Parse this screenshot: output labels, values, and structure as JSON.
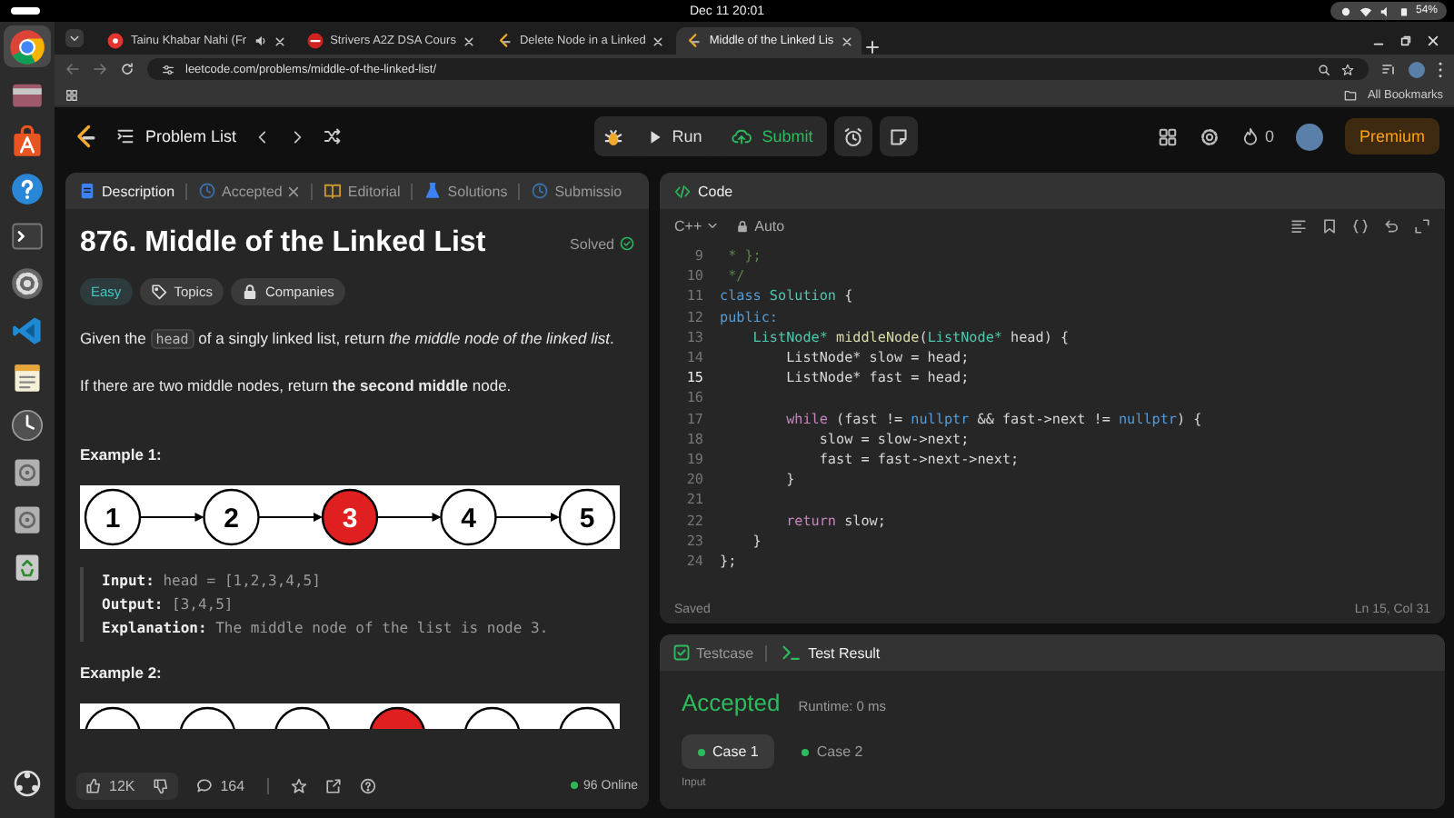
{
  "system_bar": {
    "datetime": "Dec 11  20:01",
    "battery": "54%"
  },
  "dock": [
    {
      "kind": "chrome",
      "selected": true
    },
    {
      "kind": "files",
      "selected": false
    },
    {
      "kind": "appstore",
      "selected": false
    },
    {
      "kind": "help",
      "selected": false
    },
    {
      "kind": "terminal",
      "selected": false
    },
    {
      "kind": "settings",
      "selected": false
    },
    {
      "kind": "vscode",
      "selected": false
    },
    {
      "kind": "notes",
      "selected": false
    },
    {
      "kind": "clock",
      "selected": false
    },
    {
      "kind": "disk",
      "selected": false
    },
    {
      "kind": "disk",
      "selected": false
    },
    {
      "kind": "trash",
      "selected": false
    },
    {
      "kind": "apps",
      "selected": false
    }
  ],
  "browser": {
    "tabs": [
      {
        "title": "Tainu Khabar Nahi (Fr",
        "kind": "music",
        "audio": true,
        "selected": false
      },
      {
        "title": "Strivers A2Z DSA Cours",
        "kind": "striver",
        "audio": false,
        "selected": false
      },
      {
        "title": "Delete Node in a Linked",
        "kind": "leetcode",
        "audio": false,
        "selected": false
      },
      {
        "title": "Middle of the Linked Lis",
        "kind": "leetcode",
        "audio": false,
        "selected": true
      }
    ],
    "url": "leetcode.com/problems/middle-of-the-linked-list/",
    "bookmarks": "All Bookmarks"
  },
  "header": {
    "problem_list": "Problem List",
    "run": "Run",
    "submit": "Submit",
    "streak": "0",
    "premium": "Premium"
  },
  "description_panel": {
    "tabs": [
      {
        "label": "Description",
        "kind": "description",
        "closable": false,
        "selected": true
      },
      {
        "label": "Accepted",
        "kind": "accepted",
        "closable": true,
        "selected": false
      },
      {
        "label": "Editorial",
        "kind": "editorial",
        "closable": false,
        "selected": false
      },
      {
        "label": "Solutions",
        "kind": "solutions",
        "closable": false,
        "selected": false
      },
      {
        "label": "Submissio",
        "kind": "submissions",
        "closable": false,
        "selected": false
      }
    ],
    "title": "876. Middle of the Linked List",
    "status": "Solved",
    "tags": [
      {
        "label": "Easy",
        "kind": "difficulty"
      },
      {
        "label": "Topics",
        "kind": "topics"
      },
      {
        "label": "Companies",
        "kind": "companies"
      }
    ],
    "statement": [
      {
        "kind": "text",
        "text": "Given the "
      },
      {
        "kind": "code",
        "text": "head"
      },
      {
        "kind": "text",
        "text": " of a singly linked list, return *the middle node of the linked list*."
      }
    ],
    "note": "If there are two middle nodes, return **the second middle** node.",
    "examples": [
      {
        "title": "Example 1:",
        "nodes": [
          {
            "label": "1",
            "highlighted": false
          },
          {
            "label": "2",
            "highlighted": false
          },
          {
            "label": "3",
            "highlighted": true
          },
          {
            "label": "4",
            "highlighted": false
          },
          {
            "label": "5",
            "highlighted": false
          }
        ],
        "lines": [
          "**Input:** head = [1,2,3,4,5]",
          "**Output:** [3,4,5]",
          "**Explanation:** The middle node of the list is node 3."
        ]
      },
      {
        "title": "Example 2:",
        "nodes": [
          {
            "highlighted": false
          },
          {
            "highlighted": false
          },
          {
            "highlighted": false
          },
          {
            "highlighted": true
          },
          {
            "highlighted": false
          },
          {
            "highlighted": false
          }
        ]
      }
    ],
    "footer": {
      "likes": "12K",
      "comments": "164",
      "online": "96 Online"
    }
  },
  "code_panel": {
    "title": "Code",
    "language": "C++",
    "mode": "Auto",
    "lines": [
      {
        "number": "9",
        "current": false,
        "tokens": [
          {
            "kind": "comment",
            "text": " * };"
          }
        ]
      },
      {
        "number": "10",
        "current": false,
        "tokens": [
          {
            "kind": "comment",
            "text": " */"
          }
        ]
      },
      {
        "number": "11",
        "current": false,
        "tokens": [
          {
            "kind": "keyword",
            "text": "class"
          },
          {
            "kind": "type",
            "text": " Solution"
          },
          {
            "kind": "plain",
            "text": " {"
          }
        ]
      },
      {
        "number": "12",
        "current": false,
        "tokens": [
          {
            "kind": "keyword",
            "text": "public:"
          }
        ]
      },
      {
        "number": "13",
        "current": false,
        "tokens": [
          {
            "kind": "type",
            "text": "    ListNode*"
          },
          {
            "kind": "function",
            "text": " middleNode"
          },
          {
            "kind": "plain",
            "text": "("
          },
          {
            "kind": "type",
            "text": "ListNode*"
          },
          {
            "kind": "plain",
            "text": " head) {"
          }
        ]
      },
      {
        "number": "14",
        "current": false,
        "tokens": [
          {
            "kind": "plain",
            "text": "        ListNode* slow = head;"
          }
        ]
      },
      {
        "number": "15",
        "current": true,
        "tokens": [
          {
            "kind": "plain",
            "text": "        ListNode* fast = head;"
          }
        ]
      },
      {
        "number": "16",
        "current": false
      },
      {
        "number": "17",
        "current": false,
        "tokens": [
          {
            "kind": "control",
            "text": "        while"
          },
          {
            "kind": "plain",
            "text": " (fast != "
          },
          {
            "kind": "literal",
            "text": "nullptr"
          },
          {
            "kind": "plain",
            "text": " && fast->next != "
          },
          {
            "kind": "literal",
            "text": "nullptr"
          },
          {
            "kind": "plain",
            "text": ") {"
          }
        ]
      },
      {
        "number": "18",
        "current": false,
        "tokens": [
          {
            "kind": "plain",
            "text": "            slow = slow->next;"
          }
        ]
      },
      {
        "number": "19",
        "current": false,
        "tokens": [
          {
            "kind": "plain",
            "text": "            fast = fast->next->next;"
          }
        ]
      },
      {
        "number": "20",
        "current": false,
        "tokens": [
          {
            "kind": "plain",
            "text": "        }"
          }
        ]
      },
      {
        "number": "21",
        "current": false
      },
      {
        "number": "22",
        "current": false,
        "tokens": [
          {
            "kind": "control",
            "text": "        return"
          },
          {
            "kind": "plain",
            "text": " slow;"
          }
        ]
      },
      {
        "number": "23",
        "current": false,
        "tokens": [
          {
            "kind": "plain",
            "text": "    }"
          }
        ]
      },
      {
        "number": "24",
        "current": false,
        "tokens": [
          {
            "kind": "plain",
            "text": "};"
          }
        ]
      }
    ],
    "save_state": "Saved",
    "cursor": "Ln 15, Col 31"
  },
  "test_panel": {
    "tabs": [
      {
        "label": "Testcase",
        "kind": "testcase",
        "selected": false
      },
      {
        "label": "Test Result",
        "kind": "result",
        "selected": true
      }
    ],
    "verdict": "Accepted",
    "runtime": "Runtime: 0 ms",
    "cases": [
      {
        "label": "Case 1",
        "selected": true
      },
      {
        "label": "Case 2",
        "selected": false
      }
    ],
    "section": "Input"
  }
}
